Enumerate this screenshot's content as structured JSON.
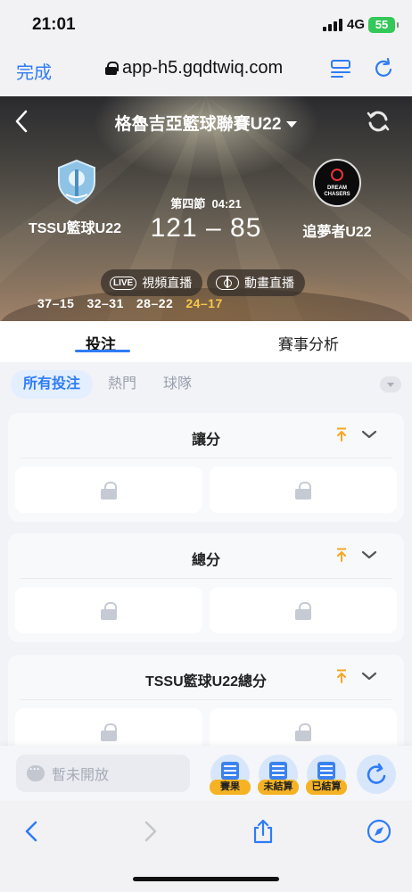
{
  "status_bar": {
    "time": "21:01",
    "network": "4G",
    "battery": "55"
  },
  "browser": {
    "done_label": "完成",
    "url": "app-h5.gqdtwiq.com"
  },
  "match": {
    "title": "格魯吉亞籃球聯賽U22",
    "period": "第四節",
    "clock": "04:21",
    "score": "121 – 85",
    "home_name": "TSSU籃球U22",
    "away_name": "追夢者U22",
    "away_logo_text": "DREAM CHASERS",
    "live_video_label": "視頻直播",
    "live_tag": "LIVE",
    "animation_label": "動畫直播",
    "quarters": [
      "37–15",
      "32–31",
      "28–22",
      "24–17"
    ]
  },
  "tabs": [
    {
      "label": "投注",
      "active": true
    },
    {
      "label": "賽事分析",
      "active": false
    }
  ],
  "filters": [
    {
      "label": "所有投注",
      "active": true
    },
    {
      "label": "熱門",
      "active": false
    },
    {
      "label": "球隊",
      "active": false
    }
  ],
  "markets": [
    {
      "title": "讓分",
      "locked": true
    },
    {
      "title": "總分",
      "locked": true
    },
    {
      "title": "TSSU籃球U22總分",
      "locked": true
    }
  ],
  "action_bar": {
    "chat_placeholder": "暫未開放",
    "results_label": "賽果",
    "unsettled_label": "未結算",
    "settled_label": "已結算"
  },
  "colors": {
    "accent": "#2f7cf6",
    "current_quarter": "#f5c84c",
    "badge": "#f5b324"
  },
  "icons": {
    "browser_top": [
      "lock-icon",
      "reader-icon",
      "reload-icon"
    ],
    "browser_bottom": [
      "back-icon",
      "forward-icon",
      "share-icon",
      "compass-icon"
    ]
  }
}
